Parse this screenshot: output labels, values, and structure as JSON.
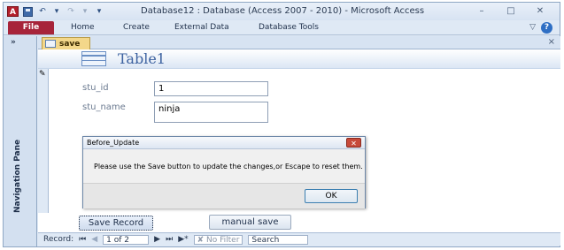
{
  "app": {
    "icon_letter": "A",
    "title": "Database12 : Database (Access 2007 - 2010)  -  Microsoft Access",
    "qat": {
      "undo": "↶",
      "undo_drop": "▾",
      "redo": "↷",
      "redo_drop": "▾",
      "customize": "▾"
    },
    "window_controls": {
      "minimize": "–",
      "maximize": "□",
      "close": "✕"
    }
  },
  "ribbon": {
    "file_tab": "File",
    "tabs": [
      "Home",
      "Create",
      "External Data",
      "Database Tools"
    ],
    "minimize_glyph": "▽",
    "help_glyph": "?"
  },
  "navigation_pane": {
    "expand_glyph": "»",
    "label": "Navigation Pane"
  },
  "document": {
    "tab_label": "save",
    "close_glyph": "×",
    "form_title": "Table1",
    "pencil_glyph": "✎",
    "fields": [
      {
        "label": "stu_id",
        "value": "1"
      },
      {
        "label": "stu_name",
        "value": "ninja"
      }
    ],
    "buttons": {
      "save_record": "Save Record",
      "manual_save": "manual save"
    }
  },
  "record_nav": {
    "label": "Record:",
    "first": "⏮",
    "prev": "◀",
    "position": "1 of 2",
    "next": "▶",
    "last": "⏭",
    "new": "▶*",
    "filter": "✘ No Filter",
    "search": "Search"
  },
  "dialog": {
    "title": "Before_Update",
    "close_glyph": "✕",
    "message": "Please use the Save button to update the changes,or Escape to reset them.",
    "ok_label": "OK"
  },
  "colors": {
    "file_tab": "#a7243a",
    "doc_tab": "#f3d78a",
    "form_title": "#3d62a0",
    "window_frame": "#dfe9f5"
  }
}
